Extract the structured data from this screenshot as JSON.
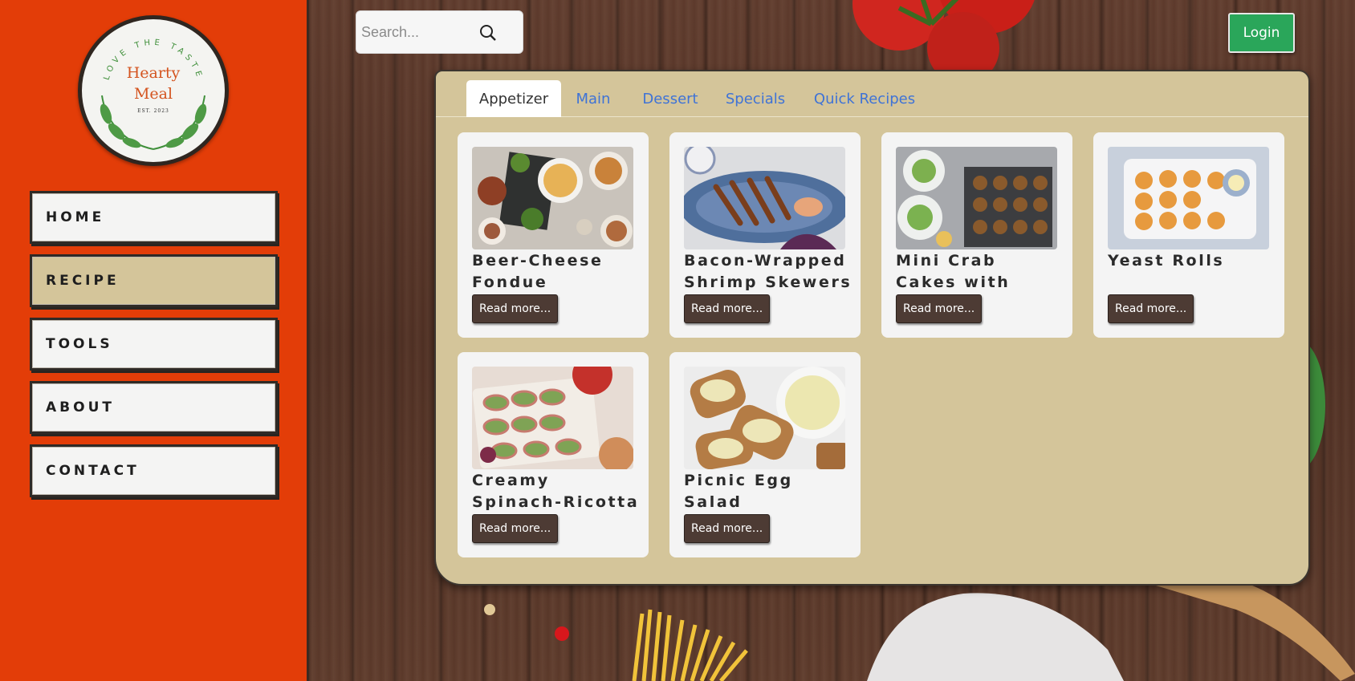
{
  "logo": {
    "arc_text": "LOVE THE TASTE",
    "name_line1": "Hearty",
    "name_line2": "Meal",
    "est": "EST. 2023"
  },
  "nav": {
    "items": [
      {
        "label": "HOME",
        "active": false
      },
      {
        "label": "RECIPE",
        "active": true
      },
      {
        "label": "TOOLS",
        "active": false
      },
      {
        "label": "ABOUT",
        "active": false
      },
      {
        "label": "CONTACT",
        "active": false
      }
    ]
  },
  "search": {
    "placeholder": "Search...",
    "value": "",
    "icon": "magnifier-icon"
  },
  "header": {
    "login_label": "Login"
  },
  "tabs": [
    {
      "label": "Appetizer",
      "active": true
    },
    {
      "label": "Main",
      "active": false
    },
    {
      "label": "Dessert",
      "active": false
    },
    {
      "label": "Specials",
      "active": false
    },
    {
      "label": "Quick Recipes",
      "active": false
    }
  ],
  "recipes": [
    {
      "title": "Beer-Cheese Fondue",
      "button": "Read more..."
    },
    {
      "title": "Bacon-Wrapped Shrimp Skewers",
      "button": "Read more..."
    },
    {
      "title": "Mini Crab Cakes with Cajun",
      "button": "Read more..."
    },
    {
      "title": "Yeast Rolls",
      "button": "Read more..."
    },
    {
      "title": "Creamy Spinach-Ricotta Crostini",
      "button": "Read more..."
    },
    {
      "title": "Picnic Egg Salad",
      "button": "Read more..."
    }
  ],
  "colors": {
    "sidebar": "#e33d08",
    "panel": "#d4c59a",
    "tab_link": "#3f73d6",
    "login": "#2aa65a",
    "read_button": "#4d3b34"
  }
}
